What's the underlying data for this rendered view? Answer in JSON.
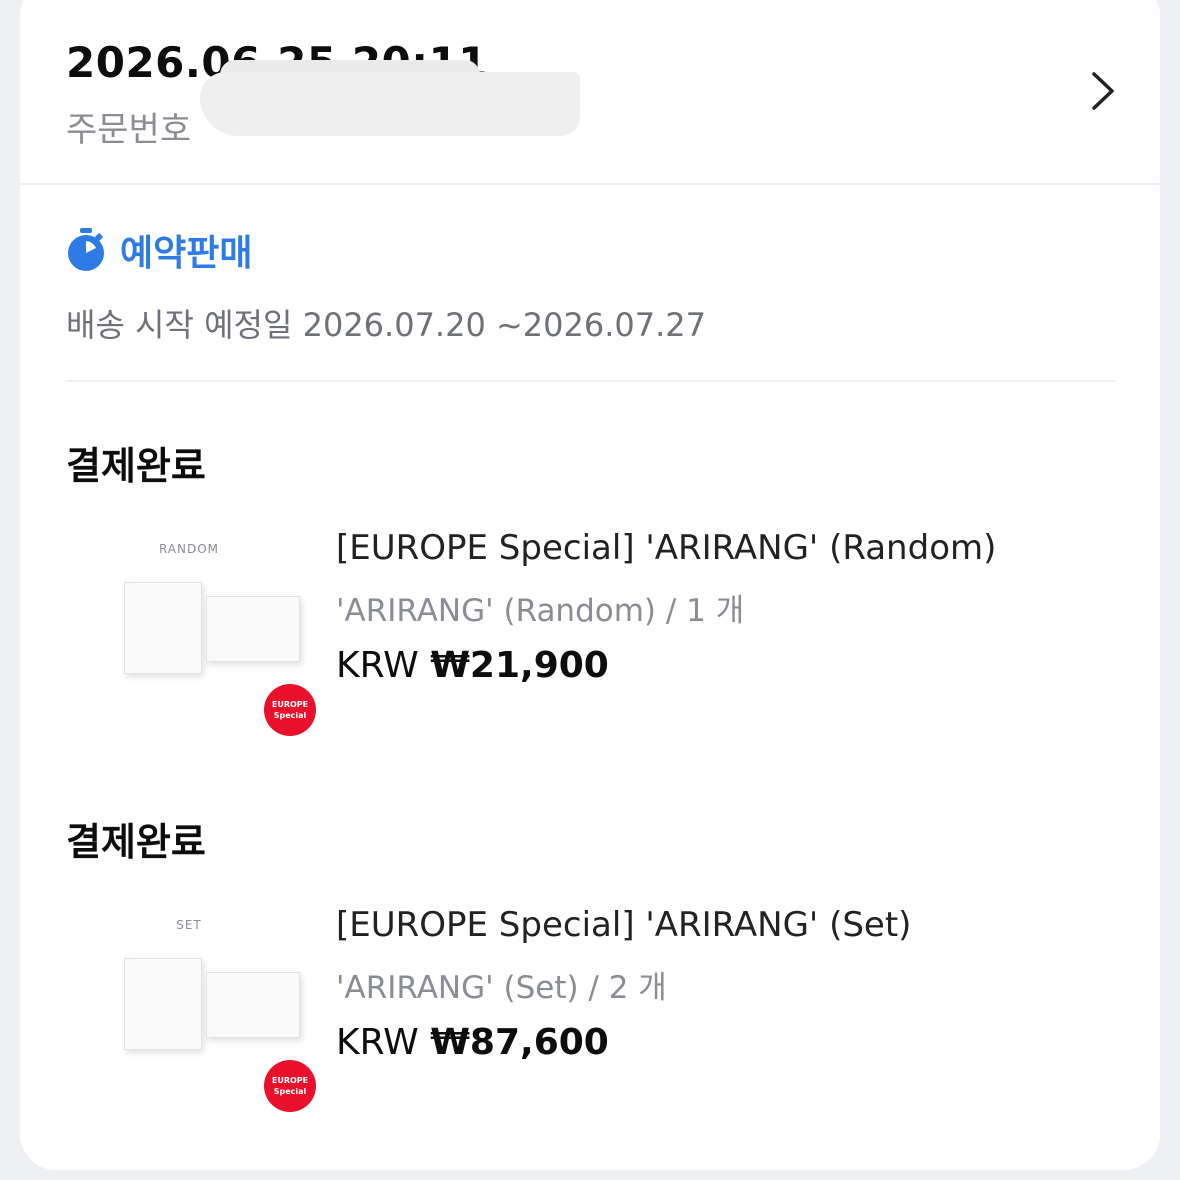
{
  "order": {
    "datetime": "2026.06.25 20:11",
    "number_label": "주문번호"
  },
  "presale": {
    "icon": "stopwatch-icon",
    "label": "예약판매",
    "ship_text": "배송 시작 예정일 2026.07.20 ~2026.07.27",
    "accent_color": "#2f7be5"
  },
  "items": [
    {
      "status": "결제완료",
      "thumb_label": "RANDOM",
      "badge_line1": "EUROPE",
      "badge_line2": "Special",
      "title": "[EUROPE Special] 'ARIRANG' (Random)",
      "option": "'ARIRANG' (Random) / 1 개",
      "currency": "KRW",
      "amount": "₩21,900"
    },
    {
      "status": "결제완료",
      "thumb_label": "SET",
      "badge_line1": "EUROPE",
      "badge_line2": "Special",
      "title": "[EUROPE Special] 'ARIRANG' (Set)",
      "option": "'ARIRANG' (Set) / 2 개",
      "currency": "KRW",
      "amount": "₩87,600"
    }
  ],
  "colors": {
    "badge": "#e8102c",
    "muted": "#8a8d93"
  }
}
